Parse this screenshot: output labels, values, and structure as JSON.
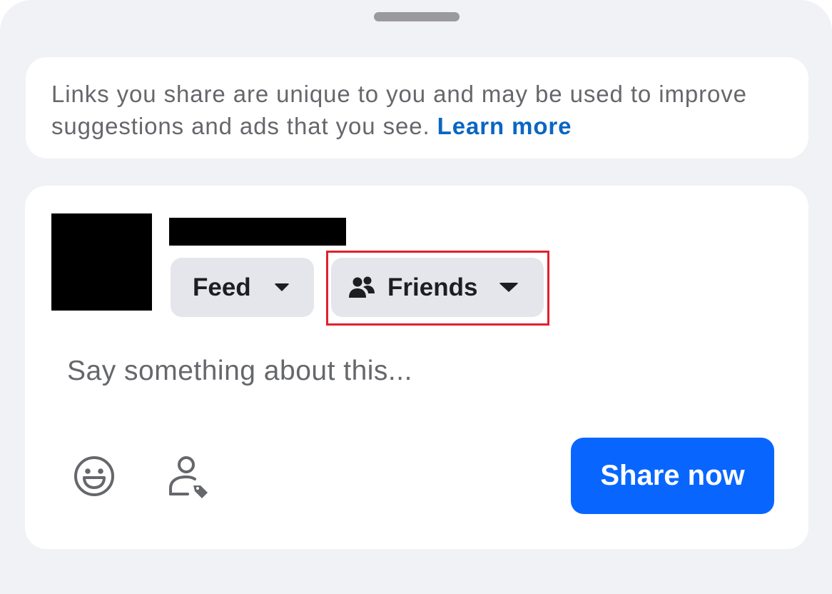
{
  "notice": {
    "text": "Links you share are unique to you and may be used to improve suggestions and ads that you see.",
    "link_label": "Learn more"
  },
  "composer": {
    "destination_label": "Feed",
    "audience_label": "Friends",
    "placeholder": "Say something about this...",
    "share_label": "Share now"
  },
  "colors": {
    "accent": "#0866ff",
    "link": "#0a66c2",
    "highlight": "#e0212e"
  },
  "icons": {
    "destination_caret": "caret-down-icon",
    "audience": "friends-icon",
    "audience_caret": "caret-down-icon",
    "emoji": "smiley-icon",
    "tag": "tag-people-icon"
  }
}
